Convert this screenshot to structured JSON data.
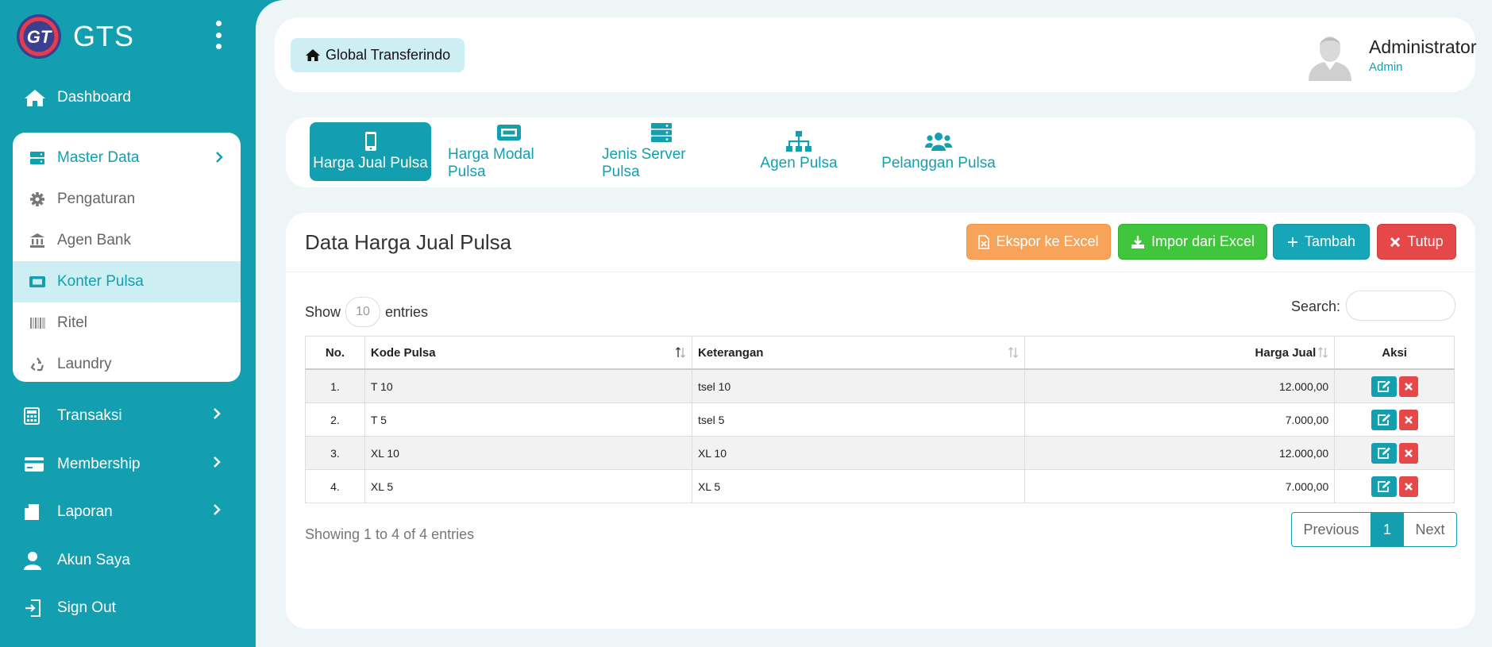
{
  "brand": {
    "name": "GTS",
    "logo_text": "GT"
  },
  "sidebar": {
    "dashboard": "Dashboard",
    "master": {
      "label": "Master Data",
      "items": [
        {
          "label": "Pengaturan",
          "icon": "gear-icon"
        },
        {
          "label": "Agen Bank",
          "icon": "bank-icon"
        },
        {
          "label": "Konter Pulsa",
          "icon": "ticket-icon",
          "active": true
        },
        {
          "label": "Ritel",
          "icon": "barcode-icon"
        },
        {
          "label": "Laundry",
          "icon": "recycle-icon"
        }
      ]
    },
    "transaksi": "Transaksi",
    "membership": "Membership",
    "laporan": "Laporan",
    "akun": "Akun Saya",
    "signout": "Sign Out"
  },
  "header": {
    "breadcrumb": "Global Transferindo",
    "user_name": "Administrator",
    "user_role": "Admin"
  },
  "tabs": [
    {
      "label": "Harga Jual Pulsa",
      "icon": "mobile-icon",
      "active": true
    },
    {
      "label": "Harga Modal Pulsa",
      "icon": "ticket-icon"
    },
    {
      "label": "Jenis Server Pulsa",
      "icon": "server-icon"
    },
    {
      "label": "Agen Pulsa",
      "icon": "sitemap-icon"
    },
    {
      "label": "Pelanggan Pulsa",
      "icon": "users-icon"
    }
  ],
  "panel": {
    "title": "Data Harga Jual Pulsa",
    "buttons": {
      "export": "Ekspor ke Excel",
      "import": "Impor dari Excel",
      "add": "Tambah",
      "close": "Tutup"
    },
    "show_label": "Show",
    "entries_label": "entries",
    "page_length": "10",
    "search_label": "Search:",
    "columns": [
      "No.",
      "Kode Pulsa",
      "Keterangan",
      "Harga Jual",
      "Aksi"
    ],
    "rows": [
      {
        "no": "1.",
        "kode": "T 10",
        "ket": "tsel 10",
        "harga": "12.000,00"
      },
      {
        "no": "2.",
        "kode": "T 5",
        "ket": "tsel 5",
        "harga": "7.000,00"
      },
      {
        "no": "3.",
        "kode": "XL 10",
        "ket": "XL 10",
        "harga": "12.000,00"
      },
      {
        "no": "4.",
        "kode": "XL 5",
        "ket": "XL 5",
        "harga": "7.000,00"
      }
    ],
    "info": "Showing 1 to 4 of 4 entries",
    "pagination": {
      "prev": "Previous",
      "current": "1",
      "next": "Next"
    }
  },
  "colors": {
    "primary": "#139fb0",
    "excel": "#f7a35a",
    "import": "#3fc63d",
    "danger": "#e54848"
  }
}
